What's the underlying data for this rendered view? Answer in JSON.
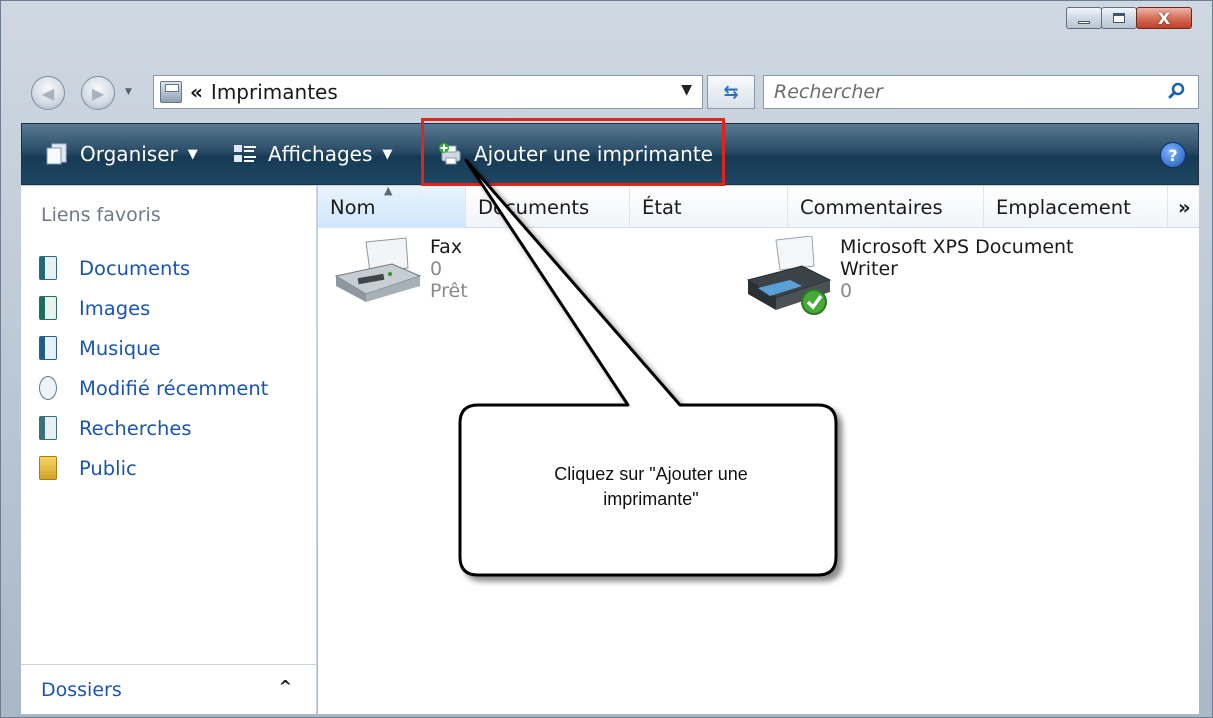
{
  "window": {
    "accent": "#2a4c66",
    "caption": {
      "minimize": "minimize",
      "maximize": "maximize",
      "close": "X"
    }
  },
  "address_bar": {
    "separator": "«",
    "path": "Imprimantes"
  },
  "search": {
    "placeholder": "Rechercher"
  },
  "toolbar": {
    "organiser_label": "Organiser",
    "affichages_label": "Affichages",
    "ajouter_label": "Ajouter une imprimante",
    "help_label": "?"
  },
  "sidebar": {
    "heading": "Liens favoris",
    "items": [
      {
        "label": "Documents",
        "icon": "documents-icon"
      },
      {
        "label": "Images",
        "icon": "images-icon"
      },
      {
        "label": "Musique",
        "icon": "music-icon"
      },
      {
        "label": "Modifié récemment",
        "icon": "recent-icon"
      },
      {
        "label": "Recherches",
        "icon": "searches-icon"
      },
      {
        "label": "Public",
        "icon": "folder-icon"
      }
    ],
    "folders_label": "Dossiers"
  },
  "columns": [
    {
      "label": "Nom"
    },
    {
      "label": "Documents"
    },
    {
      "label": "État"
    },
    {
      "label": "Commentaires"
    },
    {
      "label": "Emplacement"
    },
    {
      "label": "»"
    }
  ],
  "printers": [
    {
      "name": "Fax",
      "documents": "0",
      "status": "Prêt"
    },
    {
      "name_line1": "Microsoft XPS Document",
      "name_line2": "Writer",
      "documents": "0"
    }
  ],
  "callout": {
    "line1": "Cliquez sur \"Ajouter une",
    "line2": "imprimante\""
  }
}
